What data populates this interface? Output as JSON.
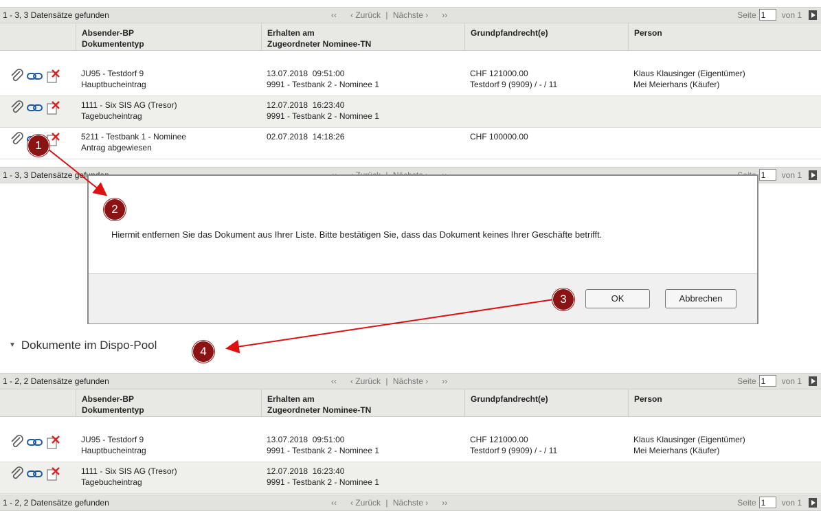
{
  "pager": {
    "first": "‹‹",
    "prev": "‹ Zurück",
    "sep": "|",
    "next": "Nächste ›",
    "last": "››",
    "page_label": "Seite",
    "page_value": "1",
    "of_label": "von 1"
  },
  "top_table": {
    "count": "1 - 3, 3 Datensätze gefunden",
    "columns": [
      {
        "line1": "Absender-BP",
        "line2": "Dokumententyp"
      },
      {
        "line1": "Erhalten am",
        "line2": "Zugeordneter Nominee-TN"
      },
      {
        "line1": "Grundpfandrecht(e)",
        "line2": ""
      },
      {
        "line1": "Person",
        "line2": ""
      }
    ],
    "rows": [
      {
        "c1a": "JU95 - Testdorf 9",
        "c1b": "Hauptbucheintrag",
        "c2a": "13.07.2018  09:51:00",
        "c2b": "9991 - Testbank 2 - Nominee 1",
        "c3a": "CHF 121000.00",
        "c3b": "Testdorf 9 (9909) / - / 11",
        "c4a": "Klaus Klausinger (Eigentümer)",
        "c4b": "Mei Meierhans (Käufer)"
      },
      {
        "c1a": "1111 - Six SIS AG (Tresor)",
        "c1b": "Tagebucheintrag",
        "c2a": "12.07.2018  16:23:40",
        "c2b": "9991 - Testbank 2 - Nominee 1",
        "c3a": "",
        "c3b": "",
        "c4a": "",
        "c4b": ""
      },
      {
        "c1a": "5211 - Testbank 1 - Nominee",
        "c1b": "Antrag abgewiesen",
        "c2a": "02.07.2018  14:18:26",
        "c2b": "",
        "c3a": "CHF 100000.00",
        "c3b": "",
        "c4a": "",
        "c4b": ""
      }
    ]
  },
  "dialog": {
    "message": "Hiermit entfernen Sie das Dokument aus Ihrer Liste. Bitte bestätigen Sie, dass das Dokument keines Ihrer Geschäfte betrifft.",
    "ok_label": "OK",
    "cancel_label": "Abbrechen"
  },
  "section": {
    "title": "Dokumente im Dispo-Pool"
  },
  "bottom_table": {
    "count": "1 - 2, 2 Datensätze gefunden",
    "rows": [
      {
        "c1a": "JU95 - Testdorf 9",
        "c1b": "Hauptbucheintrag",
        "c2a": "13.07.2018  09:51:00",
        "c2b": "9991 - Testbank 2 - Nominee 1",
        "c3a": "CHF 121000.00",
        "c3b": "Testdorf 9 (9909) / - / 11",
        "c4a": "Klaus Klausinger (Eigentümer)",
        "c4b": "Mei Meierhans (Käufer)"
      },
      {
        "c1a": "1111 - Six SIS AG (Tresor)",
        "c1b": "Tagebucheintrag",
        "c2a": "12.07.2018  16:23:40",
        "c2b": "9991 - Testbank 2 - Nominee 1",
        "c3a": "",
        "c3b": "",
        "c4a": "",
        "c4b": ""
      }
    ]
  },
  "markers": [
    "1",
    "2",
    "3",
    "4"
  ],
  "colors": {
    "marker": "#8b1313",
    "arrow": "#e01010",
    "delete_icon": "#e02020",
    "link_icon": "#1a5aa8"
  }
}
